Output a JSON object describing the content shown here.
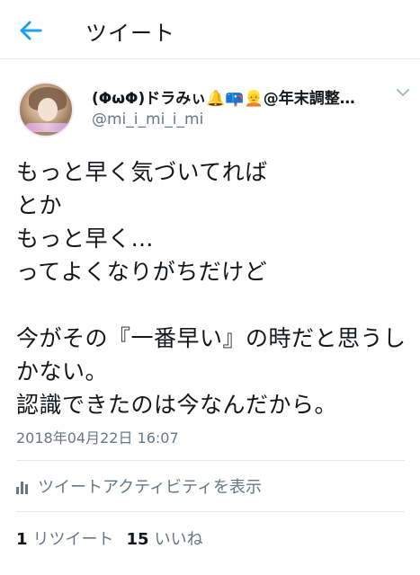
{
  "header": {
    "title": "ツイート",
    "back_icon": "arrow-left-icon",
    "accent_color": "#1da1f2"
  },
  "tweet": {
    "display_name": "(ΦωΦ)ドラみぃ🔔📪👱@年末調整…",
    "handle": "@mi_i_mi_i_mi",
    "text": "もっと早く気づいてれば\nとか\nもっと早く…\nってよくなりがちだけど\n\n今がその『一番早い』の時だと思うしかない。\n認識できたのは今なんだから。",
    "timestamp": "2018年04月22日 16:07",
    "activity_label": "ツイートアクティビティを表示",
    "retweet_count": "1",
    "retweet_label": "リツイート",
    "like_count": "15",
    "like_label": "いいね"
  }
}
